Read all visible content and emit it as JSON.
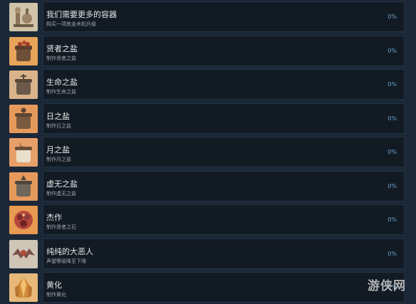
{
  "achievements": [
    {
      "title": "我们需要更多的容器",
      "description": "购买一项炼金术机升级",
      "progress": "0%",
      "icon": "alchemy-apparatus-icon",
      "bg": "#cfc3a8"
    },
    {
      "title": "贤者之盐",
      "description": "制作贤者之盐",
      "progress": "0%",
      "icon": "sage-salt-jar-icon",
      "bg": "#e8a35a"
    },
    {
      "title": "生命之盐",
      "description": "制作生命之盐",
      "progress": "0%",
      "icon": "life-salt-jar-icon",
      "bg": "#d9b38a"
    },
    {
      "title": "日之盐",
      "description": "制作日之盐",
      "progress": "0%",
      "icon": "sun-salt-jar-icon",
      "bg": "#e59a5c"
    },
    {
      "title": "月之盐",
      "description": "制作月之盐",
      "progress": "0%",
      "icon": "moon-salt-jar-icon",
      "bg": "#e8a06a"
    },
    {
      "title": "虚无之盐",
      "description": "制作虚无之盐",
      "progress": "0%",
      "icon": "void-salt-jar-icon",
      "bg": "#e59a5c"
    },
    {
      "title": "杰作",
      "description": "制作贤者之石",
      "progress": "0%",
      "icon": "philosopher-stone-icon",
      "bg": "#e89a52"
    },
    {
      "title": "纯纯的大恶人",
      "description": "声望等级降至下限",
      "progress": "0%",
      "icon": "demon-bat-icon",
      "bg": "#cfc6b8"
    },
    {
      "title": "黄化",
      "description": "制作黄化",
      "progress": "0%",
      "icon": "golden-crystal-icon",
      "bg": "#e7b87a"
    }
  ],
  "watermark": "游侠网"
}
